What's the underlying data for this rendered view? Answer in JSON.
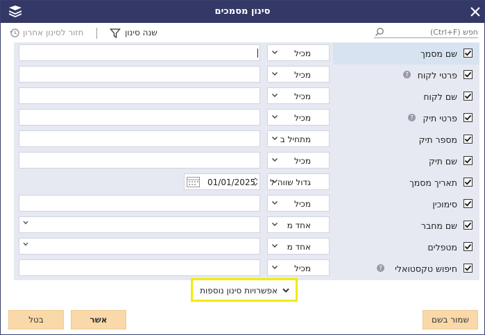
{
  "window": {
    "title": "סינון מסמכים"
  },
  "toolbar": {
    "search_placeholder": "חפש (Ctrl+F)",
    "change_filter_label": "שנה סינון",
    "back_last_filter_label": "חזור לסינון אחרון"
  },
  "rows": [
    {
      "label": "שם מסמך",
      "operator": "מכיל",
      "checked": true,
      "help": false
    },
    {
      "label": "פרטי לקוח",
      "operator": "מכיל",
      "checked": true,
      "help": true
    },
    {
      "label": "שם לקוח",
      "operator": "מכיל",
      "checked": true,
      "help": false
    },
    {
      "label": "פרטי תיק",
      "operator": "מכיל",
      "checked": true,
      "help": true
    },
    {
      "label": "מספר תיק",
      "operator": "מתחיל ב",
      "checked": true,
      "help": false
    },
    {
      "label": "שם תיק",
      "operator": "מכיל",
      "checked": true,
      "help": false
    },
    {
      "label": "תאריך מסמך",
      "operator": "גדול שווה ל",
      "checked": true,
      "help": false,
      "date": "01/01/2025"
    },
    {
      "label": "סימוכין",
      "operator": "מכיל",
      "checked": true,
      "help": false
    },
    {
      "label": "שם מחבר",
      "operator": "אחד מ",
      "checked": true,
      "help": false
    },
    {
      "label": "מטפלים",
      "operator": "אחד מ",
      "checked": true,
      "help": false
    },
    {
      "label": "חיפוש טקסטואלי",
      "operator": "מכיל",
      "checked": true,
      "help": true
    }
  ],
  "more_options_label": "אפשרויות סינון נוספות",
  "buttons": {
    "cancel": "בטל",
    "ok": "אשר",
    "save_as": "שמור בשם"
  },
  "colors": {
    "titlebar": "#333866",
    "panel": "#e6e9f2",
    "highlight_row": "#d7e3f0",
    "button": "#f9d9a9",
    "callout": "#f5ea00"
  }
}
